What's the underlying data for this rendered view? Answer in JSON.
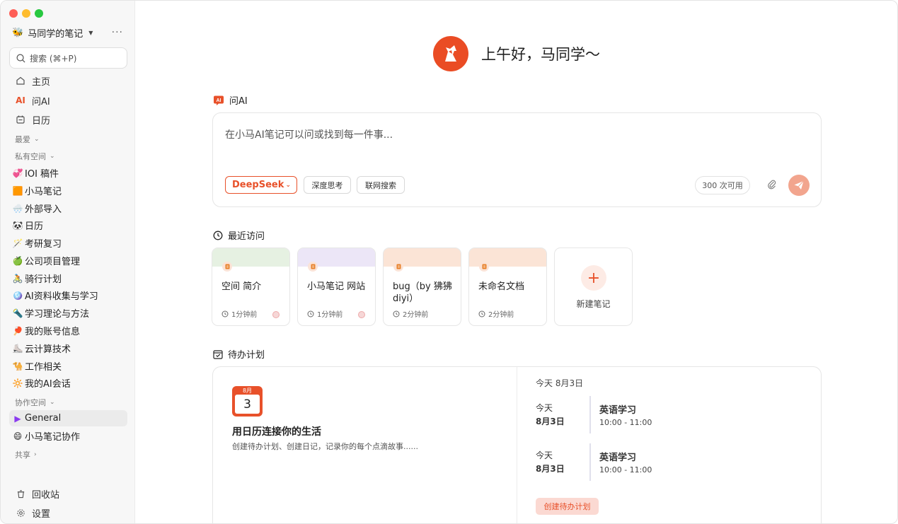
{
  "workspace": {
    "emoji": "🐝",
    "name": "马同学的笔记",
    "more": "···"
  },
  "search": {
    "label": "搜索 (⌘+P)"
  },
  "nav": [
    {
      "label": "主页",
      "icon": "home-icon"
    },
    {
      "label": "问AI",
      "icon": "ai-icon",
      "icon_text": "AI"
    },
    {
      "label": "日历",
      "icon": "calendar-icon"
    }
  ],
  "sections": {
    "favorites": "最爱",
    "private": "私有空间",
    "collab": "协作空间",
    "shared": "共享"
  },
  "private_items": [
    {
      "emoji": "💞",
      "label": "IOI 稿件"
    },
    {
      "emoji": "🟧",
      "label": "小马笔记"
    },
    {
      "emoji": "🌨️",
      "label": "外部导入"
    },
    {
      "emoji": "🐼",
      "label": "日历"
    },
    {
      "emoji": "🪄",
      "label": "考研复习"
    },
    {
      "emoji": "🍏",
      "label": "公司项目管理"
    },
    {
      "emoji": "🚴",
      "label": "骑行计划"
    },
    {
      "emoji": "🪩",
      "label": "AI资料收集与学习"
    },
    {
      "emoji": "🔦",
      "label": "学习理论与方法"
    },
    {
      "emoji": "🏓",
      "label": "我的账号信息"
    },
    {
      "emoji": "⛸️",
      "label": "云计算技术"
    },
    {
      "emoji": "🐪",
      "label": "工作相关"
    },
    {
      "emoji": "🔆",
      "label": "我的AI会话"
    }
  ],
  "collab_items": [
    {
      "emoji": "▶",
      "label": "General"
    },
    {
      "emoji": "😄",
      "label": "小马笔记协作"
    }
  ],
  "bottom": {
    "trash": "回收站",
    "settings": "设置"
  },
  "greeting": "上午好，马同学～",
  "ask": {
    "title": "问AI",
    "placeholder": "在小马AI笔记可以问或找到每一件事...",
    "model": "DeepSeek",
    "chip_deep": "深度思考",
    "chip_web": "联网搜索",
    "quota": "300 次可用"
  },
  "recent": {
    "title": "最近访问",
    "cards": [
      {
        "title": "空间 简介",
        "time": "1分钟前",
        "color": "#e6f1e2"
      },
      {
        "title": "小马笔记 网站",
        "time": "1分钟前",
        "color": "#ece6f7"
      },
      {
        "title": "bug（by 狒狒 diyi）",
        "time": "2分钟前",
        "color": "#fbe4d6"
      },
      {
        "title": "未命名文档",
        "time": "2分钟前",
        "color": "#fbe4d6"
      }
    ],
    "new_label": "新建笔记"
  },
  "todo": {
    "title": "待办计划",
    "cal_month": "8月",
    "cal_day": "3",
    "heading": "用日历连接你的生活",
    "sub": "创建待办计划、创建日记，记录你的每个点滴故事......",
    "today": "今天 8月3日",
    "events": [
      {
        "d1": "今天",
        "d2": "8月3日",
        "title": "英语学习",
        "time": "10:00 - 11:00"
      },
      {
        "d1": "今天",
        "d2": "8月3日",
        "title": "英语学习",
        "time": "10:00 - 11:00"
      }
    ],
    "create": "创建待办计划"
  },
  "colors": {
    "accent": "#e8512a",
    "sidebar_bg": "#f7f7f7"
  }
}
